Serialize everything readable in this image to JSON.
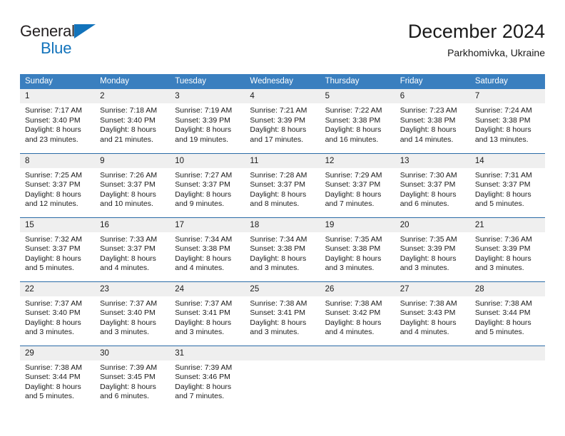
{
  "brand": {
    "name_part1": "General",
    "name_part2": "Blue",
    "triangle_icon": "triangle-icon",
    "colors": {
      "dark": "#231f20",
      "blue": "#1273bb"
    }
  },
  "header": {
    "title": "December 2024",
    "subtitle": "Parkhomivka, Ukraine"
  },
  "theme": {
    "header_blue": "#3a7fbf",
    "separator_blue": "#2a6ba6",
    "daynum_band": "#efefef",
    "text": "#1a1a1a"
  },
  "calendar": {
    "weekday_headers": [
      "Sunday",
      "Monday",
      "Tuesday",
      "Wednesday",
      "Thursday",
      "Friday",
      "Saturday"
    ],
    "weeks": [
      [
        {
          "day": "1",
          "lines": [
            "Sunrise: 7:17 AM",
            "Sunset: 3:40 PM",
            "Daylight: 8 hours",
            "and 23 minutes."
          ]
        },
        {
          "day": "2",
          "lines": [
            "Sunrise: 7:18 AM",
            "Sunset: 3:40 PM",
            "Daylight: 8 hours",
            "and 21 minutes."
          ]
        },
        {
          "day": "3",
          "lines": [
            "Sunrise: 7:19 AM",
            "Sunset: 3:39 PM",
            "Daylight: 8 hours",
            "and 19 minutes."
          ]
        },
        {
          "day": "4",
          "lines": [
            "Sunrise: 7:21 AM",
            "Sunset: 3:39 PM",
            "Daylight: 8 hours",
            "and 17 minutes."
          ]
        },
        {
          "day": "5",
          "lines": [
            "Sunrise: 7:22 AM",
            "Sunset: 3:38 PM",
            "Daylight: 8 hours",
            "and 16 minutes."
          ]
        },
        {
          "day": "6",
          "lines": [
            "Sunrise: 7:23 AM",
            "Sunset: 3:38 PM",
            "Daylight: 8 hours",
            "and 14 minutes."
          ]
        },
        {
          "day": "7",
          "lines": [
            "Sunrise: 7:24 AM",
            "Sunset: 3:38 PM",
            "Daylight: 8 hours",
            "and 13 minutes."
          ]
        }
      ],
      [
        {
          "day": "8",
          "lines": [
            "Sunrise: 7:25 AM",
            "Sunset: 3:37 PM",
            "Daylight: 8 hours",
            "and 12 minutes."
          ]
        },
        {
          "day": "9",
          "lines": [
            "Sunrise: 7:26 AM",
            "Sunset: 3:37 PM",
            "Daylight: 8 hours",
            "and 10 minutes."
          ]
        },
        {
          "day": "10",
          "lines": [
            "Sunrise: 7:27 AM",
            "Sunset: 3:37 PM",
            "Daylight: 8 hours",
            "and 9 minutes."
          ]
        },
        {
          "day": "11",
          "lines": [
            "Sunrise: 7:28 AM",
            "Sunset: 3:37 PM",
            "Daylight: 8 hours",
            "and 8 minutes."
          ]
        },
        {
          "day": "12",
          "lines": [
            "Sunrise: 7:29 AM",
            "Sunset: 3:37 PM",
            "Daylight: 8 hours",
            "and 7 minutes."
          ]
        },
        {
          "day": "13",
          "lines": [
            "Sunrise: 7:30 AM",
            "Sunset: 3:37 PM",
            "Daylight: 8 hours",
            "and 6 minutes."
          ]
        },
        {
          "day": "14",
          "lines": [
            "Sunrise: 7:31 AM",
            "Sunset: 3:37 PM",
            "Daylight: 8 hours",
            "and 5 minutes."
          ]
        }
      ],
      [
        {
          "day": "15",
          "lines": [
            "Sunrise: 7:32 AM",
            "Sunset: 3:37 PM",
            "Daylight: 8 hours",
            "and 5 minutes."
          ]
        },
        {
          "day": "16",
          "lines": [
            "Sunrise: 7:33 AM",
            "Sunset: 3:37 PM",
            "Daylight: 8 hours",
            "and 4 minutes."
          ]
        },
        {
          "day": "17",
          "lines": [
            "Sunrise: 7:34 AM",
            "Sunset: 3:38 PM",
            "Daylight: 8 hours",
            "and 4 minutes."
          ]
        },
        {
          "day": "18",
          "lines": [
            "Sunrise: 7:34 AM",
            "Sunset: 3:38 PM",
            "Daylight: 8 hours",
            "and 3 minutes."
          ]
        },
        {
          "day": "19",
          "lines": [
            "Sunrise: 7:35 AM",
            "Sunset: 3:38 PM",
            "Daylight: 8 hours",
            "and 3 minutes."
          ]
        },
        {
          "day": "20",
          "lines": [
            "Sunrise: 7:35 AM",
            "Sunset: 3:39 PM",
            "Daylight: 8 hours",
            "and 3 minutes."
          ]
        },
        {
          "day": "21",
          "lines": [
            "Sunrise: 7:36 AM",
            "Sunset: 3:39 PM",
            "Daylight: 8 hours",
            "and 3 minutes."
          ]
        }
      ],
      [
        {
          "day": "22",
          "lines": [
            "Sunrise: 7:37 AM",
            "Sunset: 3:40 PM",
            "Daylight: 8 hours",
            "and 3 minutes."
          ]
        },
        {
          "day": "23",
          "lines": [
            "Sunrise: 7:37 AM",
            "Sunset: 3:40 PM",
            "Daylight: 8 hours",
            "and 3 minutes."
          ]
        },
        {
          "day": "24",
          "lines": [
            "Sunrise: 7:37 AM",
            "Sunset: 3:41 PM",
            "Daylight: 8 hours",
            "and 3 minutes."
          ]
        },
        {
          "day": "25",
          "lines": [
            "Sunrise: 7:38 AM",
            "Sunset: 3:41 PM",
            "Daylight: 8 hours",
            "and 3 minutes."
          ]
        },
        {
          "day": "26",
          "lines": [
            "Sunrise: 7:38 AM",
            "Sunset: 3:42 PM",
            "Daylight: 8 hours",
            "and 4 minutes."
          ]
        },
        {
          "day": "27",
          "lines": [
            "Sunrise: 7:38 AM",
            "Sunset: 3:43 PM",
            "Daylight: 8 hours",
            "and 4 minutes."
          ]
        },
        {
          "day": "28",
          "lines": [
            "Sunrise: 7:38 AM",
            "Sunset: 3:44 PM",
            "Daylight: 8 hours",
            "and 5 minutes."
          ]
        }
      ],
      [
        {
          "day": "29",
          "lines": [
            "Sunrise: 7:38 AM",
            "Sunset: 3:44 PM",
            "Daylight: 8 hours",
            "and 5 minutes."
          ]
        },
        {
          "day": "30",
          "lines": [
            "Sunrise: 7:39 AM",
            "Sunset: 3:45 PM",
            "Daylight: 8 hours",
            "and 6 minutes."
          ]
        },
        {
          "day": "31",
          "lines": [
            "Sunrise: 7:39 AM",
            "Sunset: 3:46 PM",
            "Daylight: 8 hours",
            "and 7 minutes."
          ]
        },
        {
          "day": "",
          "lines": []
        },
        {
          "day": "",
          "lines": []
        },
        {
          "day": "",
          "lines": []
        },
        {
          "day": "",
          "lines": []
        }
      ]
    ]
  }
}
